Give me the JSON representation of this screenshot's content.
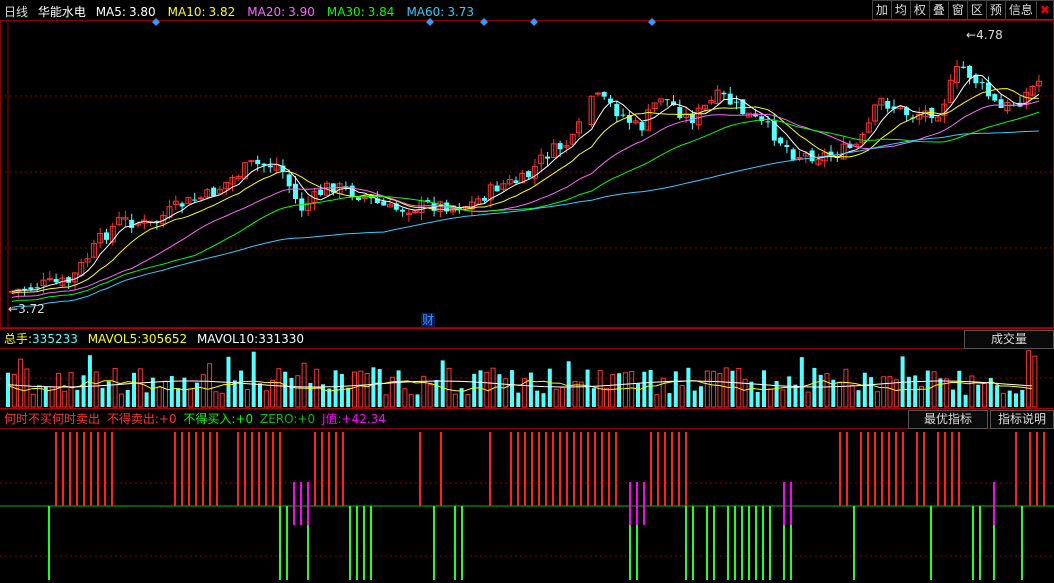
{
  "header": {
    "period": "日线",
    "stock_name": "华能水电",
    "ma": [
      {
        "label": "MA5:",
        "value": "3.80",
        "color": "#ffffff"
      },
      {
        "label": "MA10:",
        "value": "3.82",
        "color": "#ffff00"
      },
      {
        "label": "MA20:",
        "value": "3.90",
        "color": "#ff66ff"
      },
      {
        "label": "MA30:",
        "value": "3.84",
        "color": "#00ff00"
      },
      {
        "label": "MA60:",
        "value": "3.73",
        "color": "#33ccff"
      }
    ]
  },
  "toolbar": {
    "items": [
      "加",
      "均",
      "权",
      "叠",
      "窗",
      "区",
      "预",
      "信息"
    ],
    "close": "✖"
  },
  "price_panel": {
    "high_label": "4.78",
    "low_label": "3.72",
    "finance_marker": "财",
    "diamond_count": 5
  },
  "volume_panel": {
    "total_label": "总手:",
    "total_value": "335233",
    "mavol5_label": "MAVOL5:",
    "mavol5_value": "305652",
    "mavol10_label": "MAVOL10:",
    "mavol10_value": "331330",
    "dropdown_label": "成交量"
  },
  "indicator_panel": {
    "title": "何时不买何时卖出",
    "sell_label": "不得卖出:",
    "sell_value": "+0",
    "buy_label": "不得买入:",
    "buy_value": "+0",
    "zero_label": "ZERO:",
    "zero_value": "+0",
    "j_label": "J值:",
    "j_value": "+42.34",
    "best_button": "最优指标",
    "help_button": "指标说明"
  },
  "colors": {
    "up": "#ff3232",
    "down": "#54ffff",
    "ma5": "#ffffff",
    "ma10": "#ffff00",
    "ma20": "#ff66ff",
    "ma30": "#00ff00",
    "ma60": "#33ccff",
    "grid": "#8b0000",
    "sell_bar": "#ff2020",
    "buy_bar": "#20ff20",
    "mid_bar": "#ff00ff",
    "zero_line": "#00c000",
    "diamond": "#3399ff"
  }
}
